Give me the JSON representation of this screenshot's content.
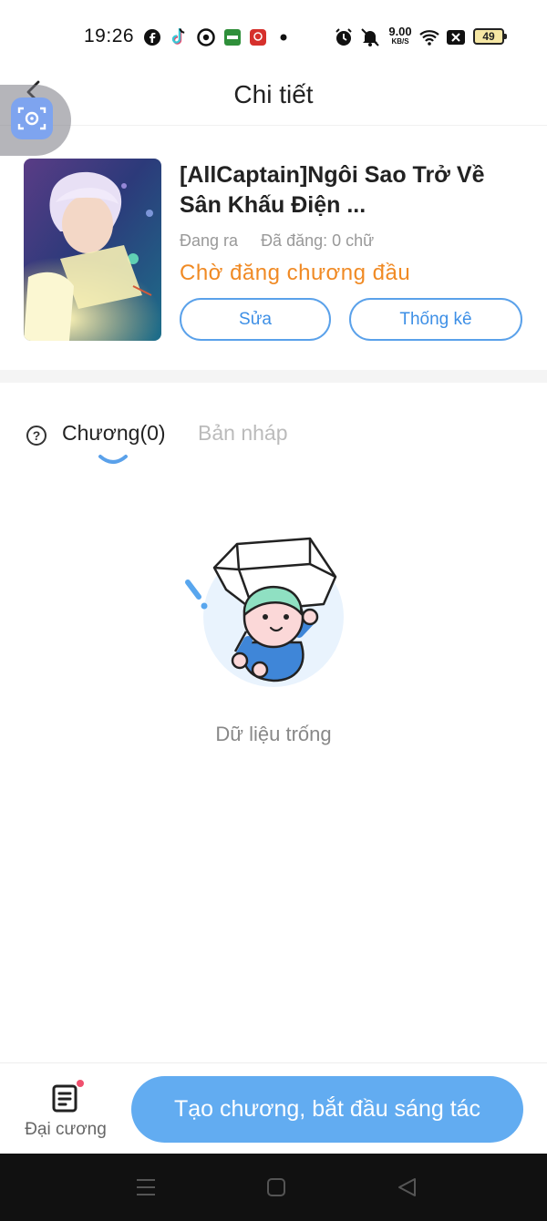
{
  "status_bar": {
    "time": "19:26",
    "app_icons": [
      "facebook-icon",
      "tiktok-icon",
      "chrome-icon",
      "vtv-app-icon",
      "red-app-icon",
      "dot-icon"
    ],
    "net_speed_value": "9.00",
    "net_speed_unit": "KB/S",
    "battery": "49"
  },
  "header": {
    "title": "Chi tiết"
  },
  "book": {
    "title": "[AllCaptain]Ngôi Sao Trở Về Sân Khấu Điện ...",
    "status_label": "Đang ra",
    "published_label": "Đã đăng: 0 chữ",
    "pending_label": "Chờ đăng chương đầu",
    "edit_button": "Sửa",
    "stats_button": "Thống kê"
  },
  "tabs": {
    "chapters": "Chương(0)",
    "drafts": "Bản nháp"
  },
  "empty_state": {
    "message": "Dữ liệu trống"
  },
  "bottom": {
    "outline_label": "Đại cương",
    "create_button": "Tạo chương, bắt đầu sáng tác"
  },
  "colors": {
    "accent": "#62acf1",
    "pending": "#f08a24",
    "outline_border": "#5aa1ea"
  }
}
